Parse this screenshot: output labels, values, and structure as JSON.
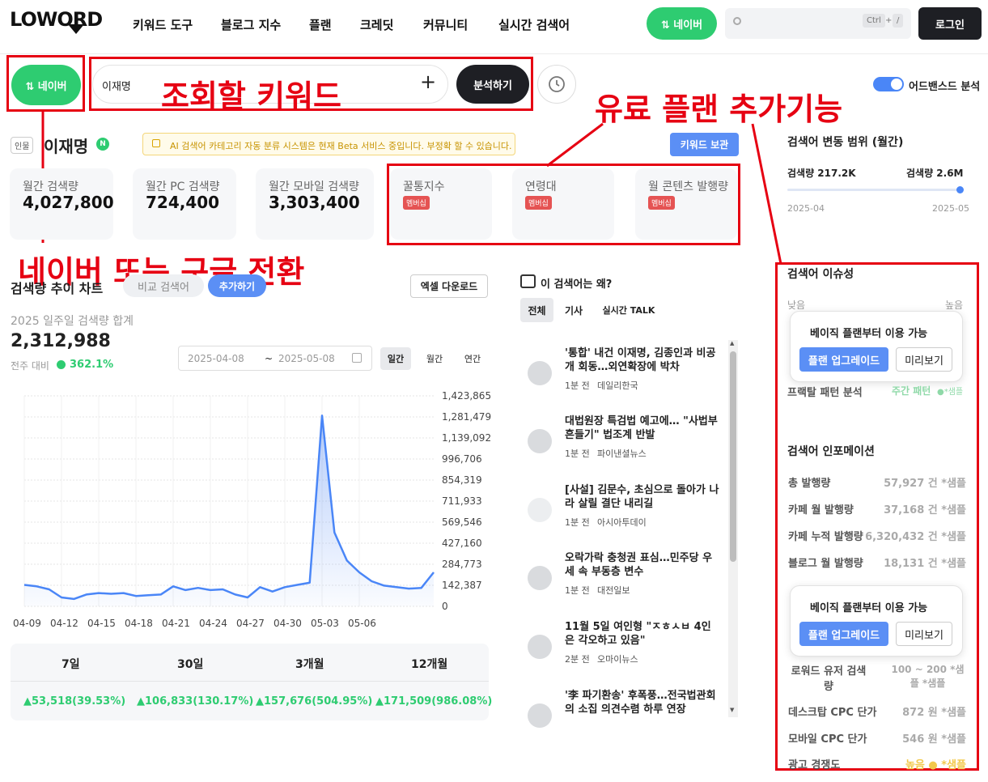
{
  "header": {
    "logo": "LOWORD",
    "nav": [
      "키워드 도구",
      "블로그 지수",
      "플랜",
      "크레딧",
      "커뮤니티",
      "실시간 검색어"
    ],
    "engine_button": "⇅ 네이버",
    "search_shortcut": [
      "Ctrl",
      "+",
      "/"
    ],
    "login": "로그인"
  },
  "search": {
    "engine_button": "⇅ 네이버",
    "keyword_value": "이재명",
    "analyze": "분석하기",
    "advanced_label": "어드밴스드 분석"
  },
  "annotations": {
    "keyword": "조회할 키워드",
    "paid": "유료 플랜 추가기능",
    "engine": "네이버 또는 구글 전환"
  },
  "keyword_head": {
    "tag": "인물",
    "name": "이재명",
    "engine_badge": "N",
    "notice": "AI 검색어 카테고리 자동 분류 시스템은 현재 Beta 서비스 중입니다. 부정확 할 수 있습니다.",
    "save_button": "키워드 보관"
  },
  "metrics": [
    {
      "title": "월간 검색량",
      "value": "4,027,800"
    },
    {
      "title": "월간 PC 검색량",
      "value": "724,400"
    },
    {
      "title": "월간 모바일 검색량",
      "value": "3,303,400"
    }
  ],
  "paid_metrics": [
    {
      "title": "꿀통지수",
      "badge": "멤버십"
    },
    {
      "title": "연령대",
      "badge": "멤버십"
    },
    {
      "title": "월 콘텐츠 발행량",
      "badge": "멤버십"
    }
  ],
  "trend": {
    "title": "검색량 추이 차트",
    "compare": "비교 검색어",
    "add": "추가하기",
    "excel": "엑셀 다운로드",
    "subtitle": "2025 일주일 검색량 합계",
    "total": "2,312,988",
    "change_label": "전주 대비",
    "change_value": "362.1%",
    "date_from": "2025-04-08",
    "date_sep": "~",
    "date_to": "2025-05-08",
    "periods": [
      "일간",
      "월간",
      "연간"
    ]
  },
  "chart_data": {
    "type": "area",
    "x_ticks": [
      "04-09",
      "04-12",
      "04-15",
      "04-18",
      "04-21",
      "04-24",
      "04-27",
      "04-30",
      "05-03",
      "05-06"
    ],
    "y_ticks": [
      "1,423,865",
      "1,281,479",
      "1,139,092",
      "996,706",
      "854,319",
      "711,933",
      "569,546",
      "427,160",
      "284,773",
      "142,387",
      "0"
    ],
    "ylim": [
      0,
      1423865
    ],
    "series": [
      {
        "values": [
          145000,
          135000,
          115000,
          60000,
          50000,
          80000,
          90000,
          85000,
          90000,
          70000,
          75000,
          80000,
          135000,
          110000,
          125000,
          110000,
          115000,
          80000,
          60000,
          130000,
          100000,
          130000,
          145000,
          160000,
          1290000,
          500000,
          310000,
          230000,
          170000,
          140000,
          130000,
          120000,
          125000,
          230000
        ]
      }
    ],
    "grid": true
  },
  "stats": {
    "headers": [
      "7일",
      "30일",
      "3개월",
      "12개월"
    ],
    "values": [
      "▲53,518(39.53%)",
      "▲106,833(130.17%)",
      "▲157,676(504.95%)",
      "▲171,509(986.08%)"
    ]
  },
  "news": {
    "title": "이 검색어는 왜?",
    "tabs": [
      "전체",
      "기사",
      "실시간 TALK"
    ],
    "items": [
      {
        "title": "'통합' 내건 이재명, 김종인과 비공개 회동…외연확장에 박차",
        "time": "1분 전",
        "source": "데일리한국"
      },
      {
        "title": "대법원장 특검법 예고에… \"사법부 흔들기\" 법조계 반발",
        "time": "1분 전",
        "source": "파이낸셜뉴스"
      },
      {
        "title": "[사설] 김문수, 초심으로 돌아가 나라 살릴 결단 내리길",
        "time": "1분 전",
        "source": "아시아투데이"
      },
      {
        "title": "오락가락 충청권 표심…민주당 우세 속 부동층 변수",
        "time": "1분 전",
        "source": "대전일보"
      },
      {
        "title": "11월 5일 여인형 \"ㅈㅎㅅㅂ 4인은 각오하고 있음\"",
        "time": "2분 전",
        "source": "오마이뉴스"
      },
      {
        "title": "'李 파기환송' 후폭풍…전국법관회의 소집 의견수렴 하루 연장",
        "time": "",
        "source": ""
      }
    ]
  },
  "range": {
    "title": "검색어 변동 범위 (월간)",
    "min_label": "검색량 217.2K",
    "max_label": "검색량 2.6M",
    "start": "2025-04",
    "end": "2025-05"
  },
  "issue": {
    "title": "검색어 이슈성",
    "low": "낮음",
    "high": "높음",
    "fractal_label": "프랙탈 패턴 분석",
    "fractal_value": "주간 패턴",
    "fractal_sample": "●*샘플",
    "upgrade_title": "베이직 플랜부터 이용 가능",
    "upgrade_btn": "플랜 업그레이드",
    "preview_btn": "미리보기"
  },
  "info": {
    "title": "검색어 인포메이션",
    "rows": [
      {
        "label": "총 발행량",
        "value": "57,927 건 *샘플"
      },
      {
        "label": "카페 월 발행량",
        "value": "37,168 건 *샘플"
      },
      {
        "label": "카페 누적 발행량",
        "value": "6,320,432 건 *샘플"
      },
      {
        "label": "블로그 월 발행량",
        "value": "18,131 건 *샘플"
      }
    ],
    "lower_rows": [
      {
        "label": "로워드 유저 검색량",
        "value": "100 ~ 200 *샘플 *샘플"
      },
      {
        "label": "데스크탑 CPC 단가",
        "value": "872 원 *샘플"
      },
      {
        "label": "모바일 CPC 단가",
        "value": "546 원 *샘플"
      },
      {
        "label": "광고 경쟁도",
        "value": "높음 ● *샘플"
      }
    ],
    "upgrade_title": "베이직 플랜부터 이용 가능",
    "upgrade_btn": "플랜 업그레이드",
    "preview_btn": "미리보기"
  }
}
